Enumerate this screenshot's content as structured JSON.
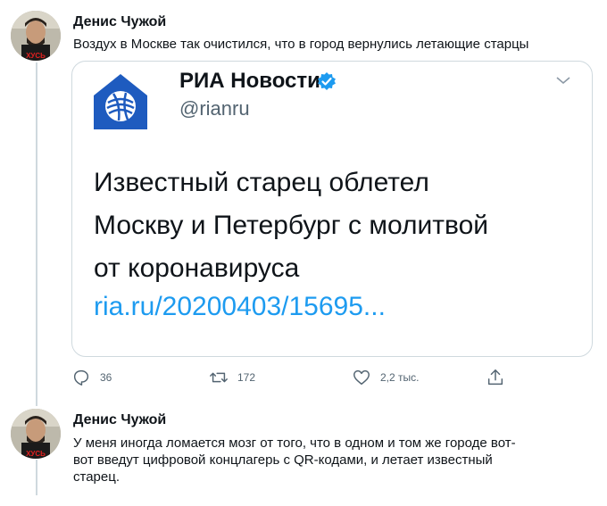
{
  "tweets": [
    {
      "author": "Денис Чужой",
      "text": "Воздух в Москве так очистился, что в город вернулись летающие старцы",
      "avatar_badge": "ХУСЬ",
      "embed": {
        "name": "РИА Новости",
        "handle": "@rianru",
        "headline_lines": [
          "Известный старец облетел",
          "Москву и Петербург с молитвой",
          "от коронавируса"
        ],
        "link": "ria.ru/20200403/15695..."
      },
      "actions": {
        "replies": "36",
        "retweets": "172",
        "likes": "2,2 тыс."
      }
    },
    {
      "author": "Денис Чужой",
      "text_lines": [
        "У меня иногда ломается мозг от того, что в одном и том же городе вот-",
        "вот введут цифровой концлагерь с QR-кодами, и летает известный",
        "старец."
      ],
      "avatar_badge": "ХУСЬ"
    }
  ],
  "colors": {
    "accent": "#1d9bf0",
    "ria_blue": "#1e5bbf",
    "text": "#0f1419",
    "muted": "#536471"
  },
  "icons": [
    "reply-icon",
    "retweet-icon",
    "like-icon",
    "share-icon",
    "verified-icon",
    "chevron-down-icon"
  ]
}
